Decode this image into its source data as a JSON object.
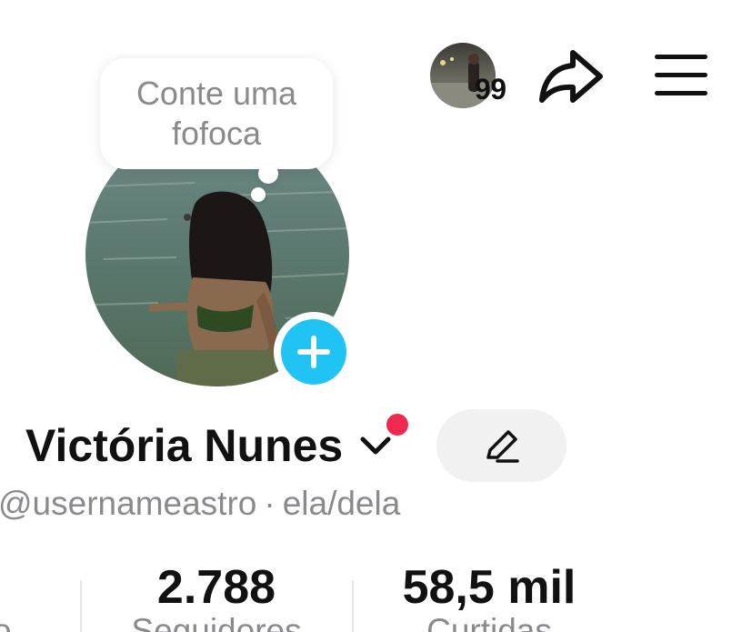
{
  "header": {
    "story_count": "99",
    "share_icon": "share-arrow-icon",
    "menu_icon": "hamburger-menu-icon"
  },
  "note_bubble": {
    "text": "Conte uma fofoca"
  },
  "profile": {
    "name": "Victória Nunes",
    "username": "@usernameastro",
    "separator": "·",
    "pronouns": "ela/dela",
    "notification_dot_color": "#ef2950",
    "add_button_color": "#20c4f4"
  },
  "stats": [
    {
      "value": "",
      "label": "o"
    },
    {
      "value": "2.788",
      "label": "Seguidores"
    },
    {
      "value": "58,5 mil",
      "label": "Curtidas"
    }
  ]
}
